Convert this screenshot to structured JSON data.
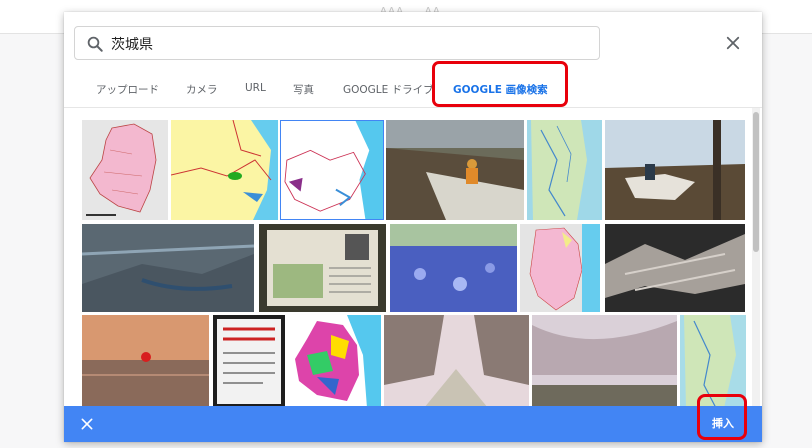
{
  "backdrop": {
    "ghost_text": "AAA..., AA..."
  },
  "search": {
    "value": "茨城県",
    "placeholder": ""
  },
  "tabs": [
    {
      "label": "アップロード",
      "active": false
    },
    {
      "label": "カメラ",
      "active": false
    },
    {
      "label": "URL",
      "active": false
    },
    {
      "label": "写真",
      "active": false
    },
    {
      "label": "GOOGLE ドライブ",
      "active": false
    },
    {
      "label": "GOOGLE 画像検索",
      "active": true
    }
  ],
  "footer": {
    "insert_label": "挿入"
  },
  "colors": {
    "accent": "#4285f4",
    "active_tab": "#1a73e8",
    "highlight": "#e8000b"
  },
  "icons": {
    "search": "search-icon",
    "close": "close-icon"
  }
}
